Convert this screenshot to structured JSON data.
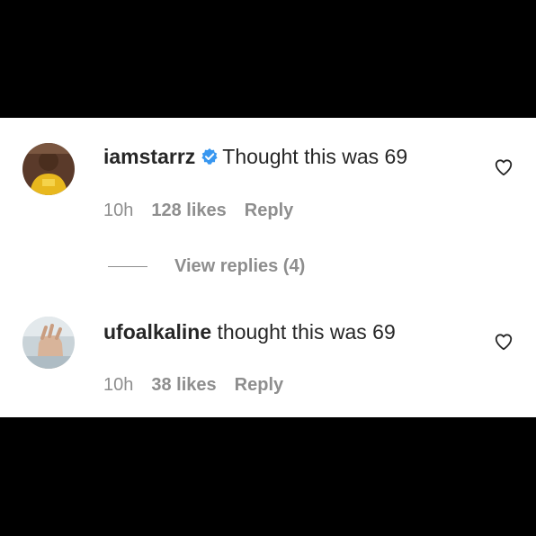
{
  "comments": [
    {
      "username": "iamstarrz",
      "verified": true,
      "text": "Thought this was 69",
      "time": "10h",
      "likes": "128 likes",
      "reply_label": "Reply"
    },
    {
      "username": "ufoalkaline",
      "verified": false,
      "text": "thought this was 69",
      "time": "10h",
      "likes": "38 likes",
      "reply_label": "Reply"
    }
  ],
  "view_replies": "View replies (4)",
  "colors": {
    "verified_badge": "#3897f0",
    "secondary_text": "#8e8e8e",
    "primary_text": "#262626"
  },
  "icons": {
    "like": "heart-outline-icon",
    "verified": "verified-badge-icon"
  }
}
